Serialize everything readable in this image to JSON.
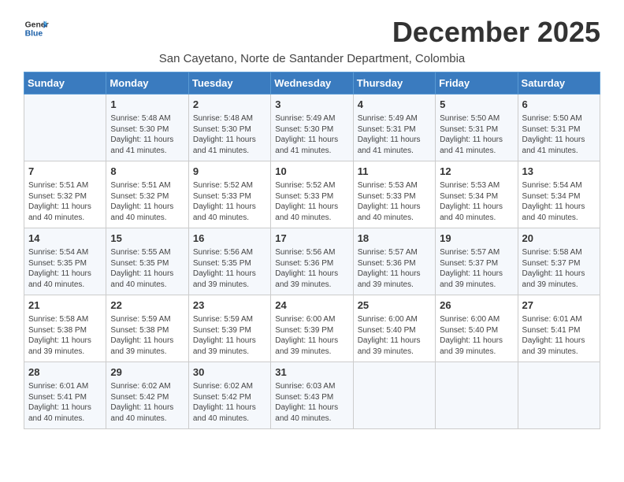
{
  "logo": {
    "line1": "General",
    "line2": "Blue"
  },
  "title": "December 2025",
  "subtitle": "San Cayetano, Norte de Santander Department, Colombia",
  "days_of_week": [
    "Sunday",
    "Monday",
    "Tuesday",
    "Wednesday",
    "Thursday",
    "Friday",
    "Saturday"
  ],
  "weeks": [
    [
      {
        "num": "",
        "sunrise": "",
        "sunset": "",
        "daylight": ""
      },
      {
        "num": "1",
        "sunrise": "Sunrise: 5:48 AM",
        "sunset": "Sunset: 5:30 PM",
        "daylight": "Daylight: 11 hours and 41 minutes."
      },
      {
        "num": "2",
        "sunrise": "Sunrise: 5:48 AM",
        "sunset": "Sunset: 5:30 PM",
        "daylight": "Daylight: 11 hours and 41 minutes."
      },
      {
        "num": "3",
        "sunrise": "Sunrise: 5:49 AM",
        "sunset": "Sunset: 5:30 PM",
        "daylight": "Daylight: 11 hours and 41 minutes."
      },
      {
        "num": "4",
        "sunrise": "Sunrise: 5:49 AM",
        "sunset": "Sunset: 5:31 PM",
        "daylight": "Daylight: 11 hours and 41 minutes."
      },
      {
        "num": "5",
        "sunrise": "Sunrise: 5:50 AM",
        "sunset": "Sunset: 5:31 PM",
        "daylight": "Daylight: 11 hours and 41 minutes."
      },
      {
        "num": "6",
        "sunrise": "Sunrise: 5:50 AM",
        "sunset": "Sunset: 5:31 PM",
        "daylight": "Daylight: 11 hours and 41 minutes."
      }
    ],
    [
      {
        "num": "7",
        "sunrise": "Sunrise: 5:51 AM",
        "sunset": "Sunset: 5:32 PM",
        "daylight": "Daylight: 11 hours and 40 minutes."
      },
      {
        "num": "8",
        "sunrise": "Sunrise: 5:51 AM",
        "sunset": "Sunset: 5:32 PM",
        "daylight": "Daylight: 11 hours and 40 minutes."
      },
      {
        "num": "9",
        "sunrise": "Sunrise: 5:52 AM",
        "sunset": "Sunset: 5:33 PM",
        "daylight": "Daylight: 11 hours and 40 minutes."
      },
      {
        "num": "10",
        "sunrise": "Sunrise: 5:52 AM",
        "sunset": "Sunset: 5:33 PM",
        "daylight": "Daylight: 11 hours and 40 minutes."
      },
      {
        "num": "11",
        "sunrise": "Sunrise: 5:53 AM",
        "sunset": "Sunset: 5:33 PM",
        "daylight": "Daylight: 11 hours and 40 minutes."
      },
      {
        "num": "12",
        "sunrise": "Sunrise: 5:53 AM",
        "sunset": "Sunset: 5:34 PM",
        "daylight": "Daylight: 11 hours and 40 minutes."
      },
      {
        "num": "13",
        "sunrise": "Sunrise: 5:54 AM",
        "sunset": "Sunset: 5:34 PM",
        "daylight": "Daylight: 11 hours and 40 minutes."
      }
    ],
    [
      {
        "num": "14",
        "sunrise": "Sunrise: 5:54 AM",
        "sunset": "Sunset: 5:35 PM",
        "daylight": "Daylight: 11 hours and 40 minutes."
      },
      {
        "num": "15",
        "sunrise": "Sunrise: 5:55 AM",
        "sunset": "Sunset: 5:35 PM",
        "daylight": "Daylight: 11 hours and 40 minutes."
      },
      {
        "num": "16",
        "sunrise": "Sunrise: 5:56 AM",
        "sunset": "Sunset: 5:35 PM",
        "daylight": "Daylight: 11 hours and 39 minutes."
      },
      {
        "num": "17",
        "sunrise": "Sunrise: 5:56 AM",
        "sunset": "Sunset: 5:36 PM",
        "daylight": "Daylight: 11 hours and 39 minutes."
      },
      {
        "num": "18",
        "sunrise": "Sunrise: 5:57 AM",
        "sunset": "Sunset: 5:36 PM",
        "daylight": "Daylight: 11 hours and 39 minutes."
      },
      {
        "num": "19",
        "sunrise": "Sunrise: 5:57 AM",
        "sunset": "Sunset: 5:37 PM",
        "daylight": "Daylight: 11 hours and 39 minutes."
      },
      {
        "num": "20",
        "sunrise": "Sunrise: 5:58 AM",
        "sunset": "Sunset: 5:37 PM",
        "daylight": "Daylight: 11 hours and 39 minutes."
      }
    ],
    [
      {
        "num": "21",
        "sunrise": "Sunrise: 5:58 AM",
        "sunset": "Sunset: 5:38 PM",
        "daylight": "Daylight: 11 hours and 39 minutes."
      },
      {
        "num": "22",
        "sunrise": "Sunrise: 5:59 AM",
        "sunset": "Sunset: 5:38 PM",
        "daylight": "Daylight: 11 hours and 39 minutes."
      },
      {
        "num": "23",
        "sunrise": "Sunrise: 5:59 AM",
        "sunset": "Sunset: 5:39 PM",
        "daylight": "Daylight: 11 hours and 39 minutes."
      },
      {
        "num": "24",
        "sunrise": "Sunrise: 6:00 AM",
        "sunset": "Sunset: 5:39 PM",
        "daylight": "Daylight: 11 hours and 39 minutes."
      },
      {
        "num": "25",
        "sunrise": "Sunrise: 6:00 AM",
        "sunset": "Sunset: 5:40 PM",
        "daylight": "Daylight: 11 hours and 39 minutes."
      },
      {
        "num": "26",
        "sunrise": "Sunrise: 6:00 AM",
        "sunset": "Sunset: 5:40 PM",
        "daylight": "Daylight: 11 hours and 39 minutes."
      },
      {
        "num": "27",
        "sunrise": "Sunrise: 6:01 AM",
        "sunset": "Sunset: 5:41 PM",
        "daylight": "Daylight: 11 hours and 39 minutes."
      }
    ],
    [
      {
        "num": "28",
        "sunrise": "Sunrise: 6:01 AM",
        "sunset": "Sunset: 5:41 PM",
        "daylight": "Daylight: 11 hours and 40 minutes."
      },
      {
        "num": "29",
        "sunrise": "Sunrise: 6:02 AM",
        "sunset": "Sunset: 5:42 PM",
        "daylight": "Daylight: 11 hours and 40 minutes."
      },
      {
        "num": "30",
        "sunrise": "Sunrise: 6:02 AM",
        "sunset": "Sunset: 5:42 PM",
        "daylight": "Daylight: 11 hours and 40 minutes."
      },
      {
        "num": "31",
        "sunrise": "Sunrise: 6:03 AM",
        "sunset": "Sunset: 5:43 PM",
        "daylight": "Daylight: 11 hours and 40 minutes."
      },
      {
        "num": "",
        "sunrise": "",
        "sunset": "",
        "daylight": ""
      },
      {
        "num": "",
        "sunrise": "",
        "sunset": "",
        "daylight": ""
      },
      {
        "num": "",
        "sunrise": "",
        "sunset": "",
        "daylight": ""
      }
    ]
  ]
}
